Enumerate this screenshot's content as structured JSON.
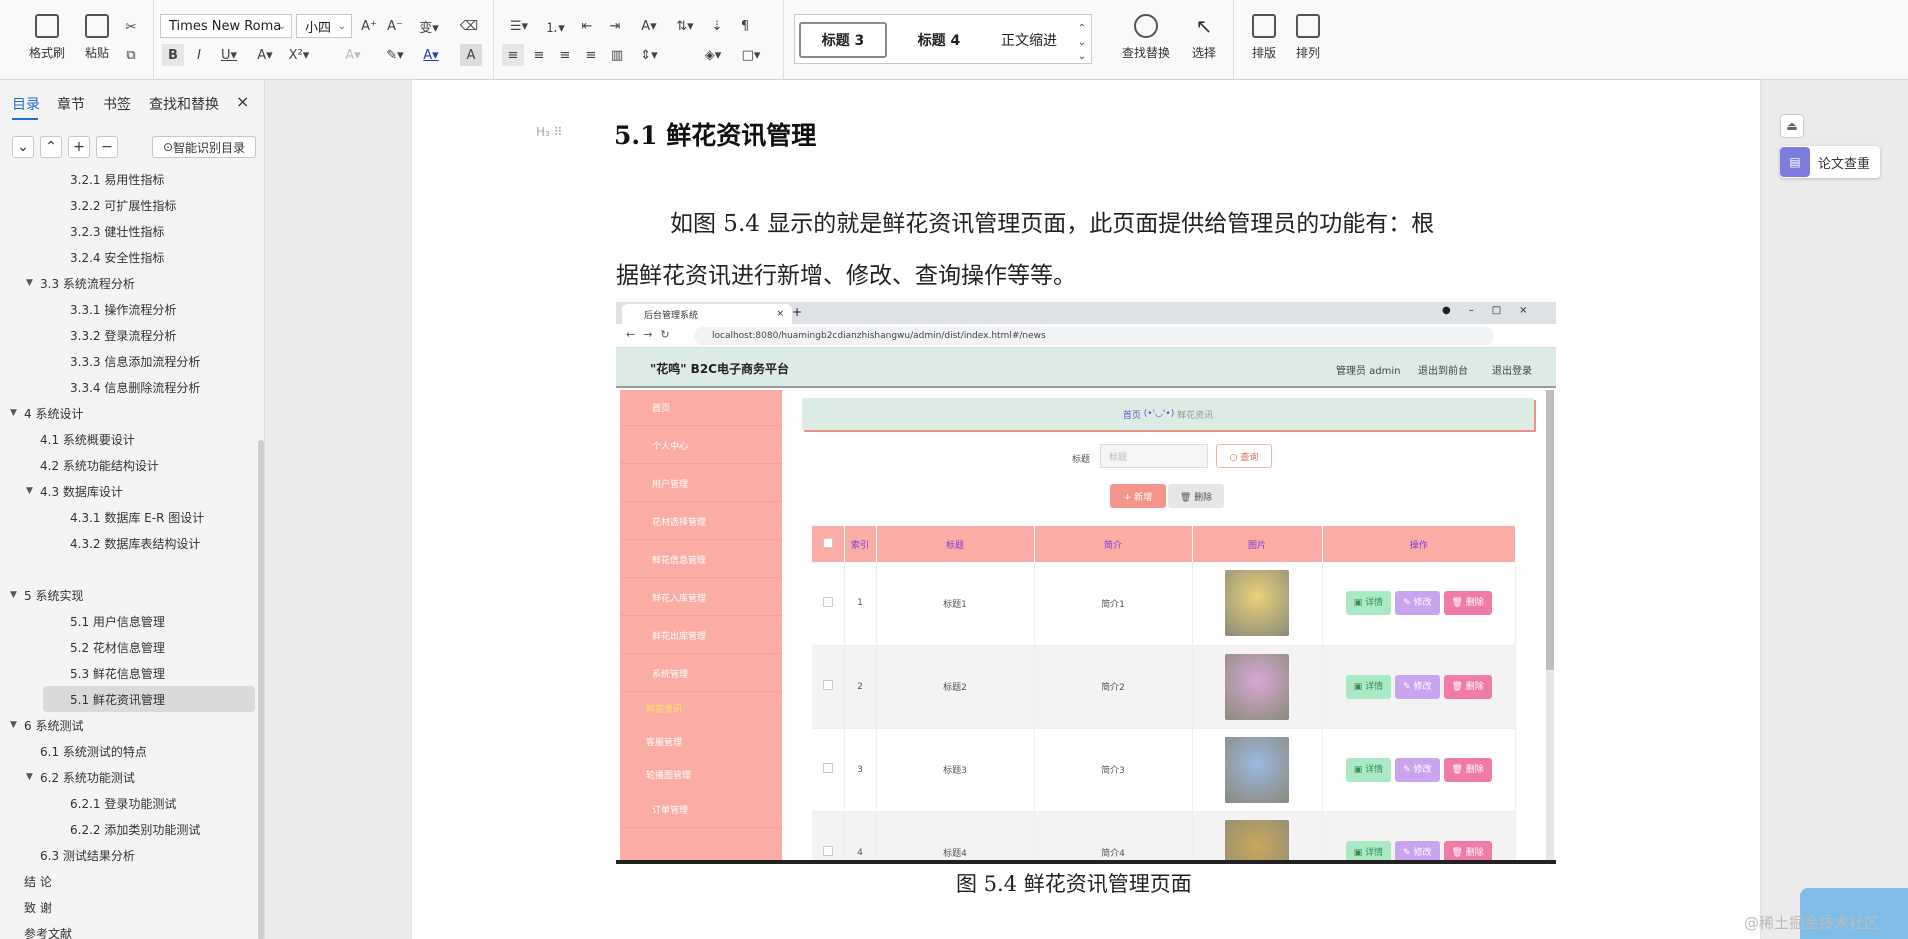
{
  "ribbon": {
    "format_painter": "格式刷",
    "paste": "粘贴",
    "font_name": "Times New Roma",
    "font_size": "小四",
    "styles": [
      "标题 3",
      "标题 4",
      "正文缩进"
    ],
    "find_replace": "查找替换",
    "select": "选择",
    "layout": "排版",
    "arrange": "排列"
  },
  "panel": {
    "tabs": [
      "目录",
      "章节",
      "书签",
      "查找和替换"
    ],
    "close": "×",
    "smart_toc": "智能识别目录",
    "toc": [
      {
        "text": "3.2.1  易用性指标",
        "level": 3
      },
      {
        "text": "3.2.2  可扩展性指标",
        "level": 3
      },
      {
        "text": "3.2.3  健壮性指标",
        "level": 3
      },
      {
        "text": "3.2.4  安全性指标",
        "level": 3
      },
      {
        "text": "3.3  系统流程分析",
        "level": 2,
        "expanded": true
      },
      {
        "text": "3.3.1  操作流程分析",
        "level": 3
      },
      {
        "text": "3.3.2  登录流程分析",
        "level": 3
      },
      {
        "text": "3.3.3  信息添加流程分析",
        "level": 3
      },
      {
        "text": "3.3.4  信息删除流程分析",
        "level": 3
      },
      {
        "text": "4  系统设计",
        "level": 1,
        "expanded": true
      },
      {
        "text": "4.1  系统概要设计",
        "level": 2
      },
      {
        "text": "4.2  系统功能结构设计",
        "level": 2
      },
      {
        "text": "4.3  数据库设计",
        "level": 2,
        "expanded": true
      },
      {
        "text": "4.3.1  数据库 E-R 图设计",
        "level": 3
      },
      {
        "text": "4.3.2  数据库表结构设计",
        "level": 3
      },
      {
        "text": "",
        "level": 1
      },
      {
        "text": "5  系统实现",
        "level": 1,
        "expanded": true
      },
      {
        "text": "5.1 用户信息管理",
        "level": 3
      },
      {
        "text": "5.2  花材信息管理",
        "level": 3
      },
      {
        "text": "5.3 鲜花信息管理",
        "level": 3
      },
      {
        "text": "5.1 鲜花资讯管理",
        "level": 3,
        "selected": true
      },
      {
        "text": "6  系统测试",
        "level": 1,
        "expanded": true
      },
      {
        "text": "6.1  系统测试的特点",
        "level": 2
      },
      {
        "text": "6.2  系统功能测试",
        "level": 2,
        "expanded": true
      },
      {
        "text": "6.2.1  登录功能测试",
        "level": 3
      },
      {
        "text": "6.2.2  添加类别功能测试",
        "level": 3
      },
      {
        "text": "6.3  测试结果分析",
        "level": 2
      },
      {
        "text": "结    论",
        "level": 1
      },
      {
        "text": "致    谢",
        "level": 1
      },
      {
        "text": "参考文献",
        "level": 1
      }
    ]
  },
  "doc": {
    "heading_marker": "H₃ ⠿",
    "heading": "5.1 鲜花资讯管理",
    "para_line1": "如图 5.4 显示的就是鲜花资讯管理页面，此页面提供给管理员的功能有：根",
    "para_line2": "据鲜花资讯进行新增、修改、查询操作等等。",
    "caption": "图 5.4  鲜花资讯管理页面"
  },
  "shot": {
    "tab_title": "后台管理系统",
    "url": "localhost:8080/huamingb2cdianzhishangwu/admin/dist/index.html#/news",
    "app_title": "\"花鸣\" B2C电子商务平台",
    "user": "管理员 admin",
    "to_front": "退出到前台",
    "logout": "退出登录",
    "nav": [
      "首页",
      "个人中心",
      "用户管理",
      "花材选择管理",
      "鲜花信息管理",
      "鲜花入库管理",
      "鲜花出库管理",
      "系统管理",
      "鲜花资讯",
      "客服管理",
      "轮播图管理",
      "订单管理"
    ],
    "breadcrumb_home": "首页",
    "breadcrumb_face": "(•'◡'•)",
    "breadcrumb_page": "鲜花资讯",
    "search_label": "标题",
    "search_placeholder": "标题",
    "search_btn": "○ 查询",
    "add_btn": "+ 新增",
    "del_btn": "🗑 删除",
    "headers": [
      "索引",
      "标题",
      "简介",
      "图片",
      "操作"
    ],
    "rows": [
      {
        "idx": "1",
        "title": "标题1",
        "brief": "简介1"
      },
      {
        "idx": "2",
        "title": "标题2",
        "brief": "简介2"
      },
      {
        "idx": "3",
        "title": "标题3",
        "brief": "简介3"
      },
      {
        "idx": "4",
        "title": "标题4",
        "brief": "简介4"
      }
    ],
    "detail": "详情",
    "edit": "修改",
    "remove": "删除"
  },
  "right": {
    "paper_check": "论文查重"
  },
  "watermark": "@稀土掘金技术社区",
  "colors": {
    "accent": "#1f6fd6",
    "nav": "#fbaca5",
    "appbar": "#dcebe3",
    "detail": "#a9e9c4",
    "edit": "#c9a5f0",
    "delete": "#f07aa8"
  }
}
